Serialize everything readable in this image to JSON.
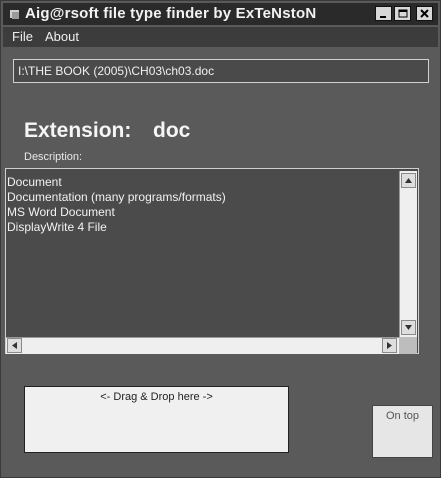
{
  "window": {
    "title": "Aig@rsoft file type finder by ExTeNstoN",
    "controls": {
      "minimize": "minimize-icon",
      "maximize": "maximize-icon",
      "close": "close-icon"
    }
  },
  "menu": {
    "file": "File",
    "about": "About"
  },
  "path": {
    "value": "I:\\THE BOOK (2005)\\CH03\\ch03.doc"
  },
  "extension": {
    "label": "Extension:",
    "value": "doc"
  },
  "description": {
    "label": "Description:",
    "items": [
      "Document",
      "Documentation (many programs/formats)",
      "MS Word Document",
      "DisplayWrite 4 File"
    ]
  },
  "dropzone": {
    "label": "<- Drag & Drop here ->"
  },
  "ontop": {
    "label": "On top"
  }
}
